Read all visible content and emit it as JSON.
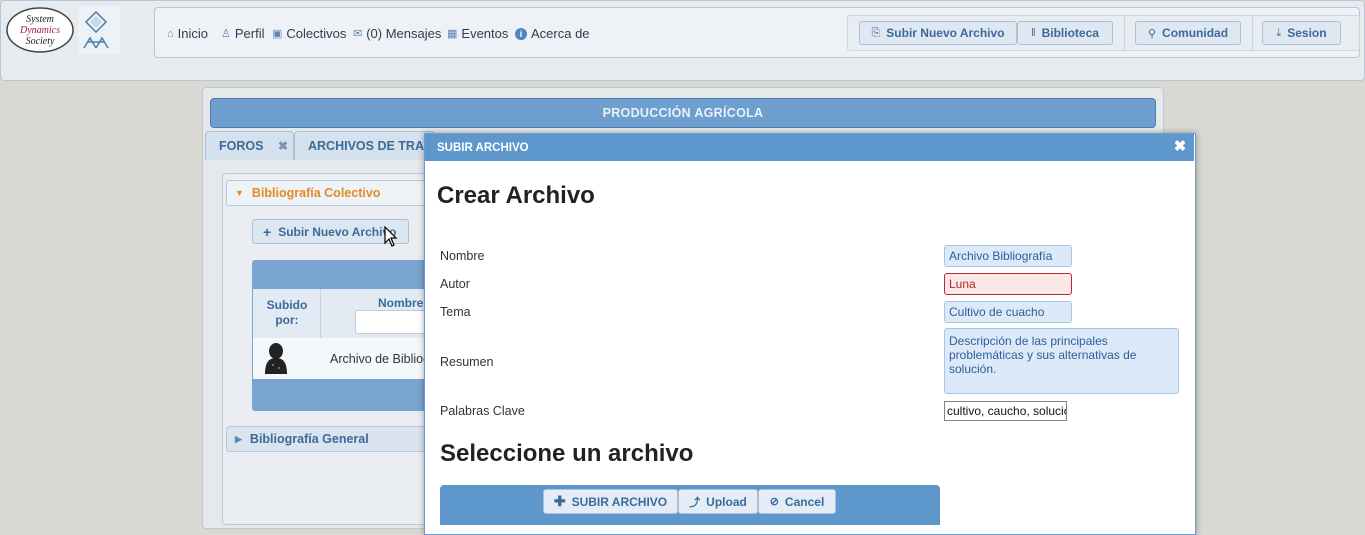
{
  "logo": {
    "text": "System Dynamics Society"
  },
  "nav": {
    "items": [
      {
        "label": "Inicio",
        "icon": "home-icon"
      },
      {
        "label": "Perfil",
        "icon": "user-icon"
      },
      {
        "label": "Colectivos",
        "icon": "group-icon"
      },
      {
        "label": "(0) Mensajes",
        "icon": "mail-icon"
      },
      {
        "label": "Eventos",
        "icon": "calendar-icon"
      },
      {
        "label": "Acerca de",
        "icon": "info-icon"
      }
    ],
    "buttons": {
      "subir": "Subir Nuevo Archivo",
      "biblioteca": "Biblioteca",
      "comunidad": "Comunidad",
      "sesion": "Sesion"
    }
  },
  "page": {
    "title": "PRODUCCIÓN AGRÍCOLA",
    "tabs": [
      "FOROS",
      "ARCHIVOS DE TRAB"
    ],
    "accordion": {
      "section1": "Bibliografía Colectivo",
      "section2": "Bibliografía General"
    },
    "subir_btn": "Subir Nuevo Archivo",
    "grid": {
      "col_subido": "Subido por:",
      "col_nombre": "Nombre",
      "row_nombre": "Archivo de Bibliog"
    }
  },
  "modal": {
    "header": "SUBIR ARCHIVO",
    "heading": "Crear Archivo",
    "labels": {
      "nombre": "Nombre",
      "autor": "Autor",
      "tema": "Tema",
      "resumen": "Resumen",
      "palabras": "Palabras Clave"
    },
    "values": {
      "nombre": "Archivo Bibliografía",
      "autor": "Luna",
      "tema": "Cultivo de cuacho",
      "resumen": "Descripción de las principales problemáticas y sus alternativas de solución.",
      "palabras": "cultivo, caucho, solucion"
    },
    "select_heading": "Seleccione un archivo",
    "upload_buttons": {
      "subir": "SUBIR ARCHIVO",
      "upload": "Upload",
      "cancel": "Cancel"
    }
  },
  "colors": {
    "accent": "#5d97cc",
    "title_bar": "#6e9fcf",
    "active_section": "#e48a26",
    "error": "#c0282d"
  }
}
